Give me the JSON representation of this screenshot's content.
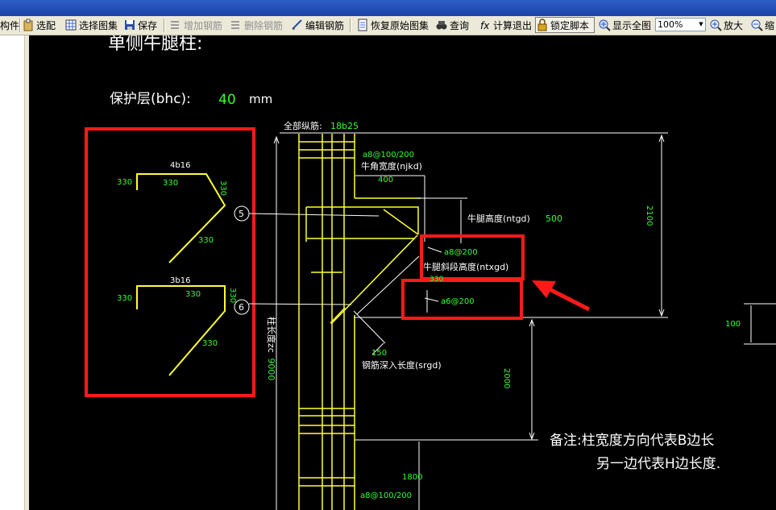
{
  "toolbar": {
    "component": "构件",
    "select_config": "选配",
    "select_atlas": "选择图集",
    "save": "保存",
    "add_rebar": "增加钢筋",
    "delete_rebar": "删除钢筋",
    "edit_rebar": "编辑钢筋",
    "restore_atlas": "恢复原始图集",
    "query": "查询",
    "calc_exit": "计算退出",
    "lock_script": "锁定脚本",
    "show_all": "显示全图",
    "zoom_value": "100%",
    "zoom_in": "放大",
    "zoom_out": "缩"
  },
  "drawing": {
    "title": "单侧牛腿柱:",
    "cover_label": "保护层(bhc):",
    "cover_value": "40",
    "cover_unit": "mm",
    "all_long_rebar_label": "全部纵筋:",
    "all_long_rebar_value": "18b25",
    "stirrup_top": "a8@100/200",
    "corner_width_label": "牛角宽度(njkd)",
    "corner_width_value": "400",
    "corbel_height_label": "牛腿高度(ntgd)",
    "corbel_height_value": "500",
    "total_height_value": "2100",
    "stirrup_corbel_1": "a8@200",
    "slope_height_label": "牛腿斜段高度(ntxgd)",
    "stirrup_corbel_2": "a6@200",
    "anchor_value": "150",
    "anchor_label": "钢筋深入长度(srgd)",
    "lower_height_value": "2000",
    "bottom_height_value": "1800",
    "stirrup_bottom": "a8@100/200",
    "column_length_label": "柱长度zc",
    "column_length_value": "9000",
    "right_dim_value": "100",
    "note_line1": "备注:柱宽度方向代表B边长",
    "note_line2": "另一边代表H边长度.",
    "rebar1": {
      "bubble": "5",
      "spec": "4b16",
      "a": "330",
      "b": "330",
      "c": "330",
      "d": "330"
    },
    "rebar2": {
      "bubble": "6",
      "spec": "3b16",
      "a": "330",
      "b": "330",
      "c": "330",
      "d": "330"
    },
    "partial_text": "330"
  },
  "colors": {
    "canvas_bg": "#000000",
    "rebar_yellow": "#ffff33",
    "value_green": "#33ff33",
    "line_white": "#ffffff",
    "highlight_red": "#ff1a1a",
    "toolbar_bg": "#ece9d8",
    "titlebar_blue": "#1c43a8"
  }
}
